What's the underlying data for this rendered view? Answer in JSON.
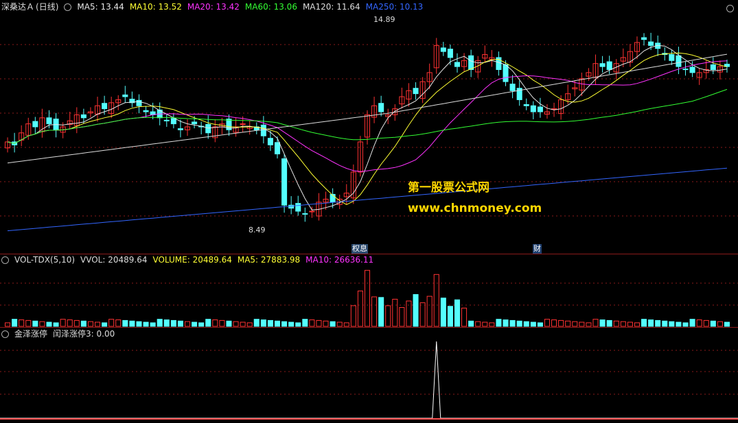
{
  "main": {
    "stock": "深桑达Ａ",
    "period": "(日线)",
    "ma": [
      {
        "label": "MA5: 13.44",
        "color": "#e6e6e6"
      },
      {
        "label": "MA10: 13.52",
        "color": "#ffff33"
      },
      {
        "label": "MA20: 13.42",
        "color": "#ff33ff"
      },
      {
        "label": "MA60: 13.06",
        "color": "#33ff33"
      },
      {
        "label": "MA120: 11.64",
        "color": "#dddddd"
      },
      {
        "label": "MA250: 10.13",
        "color": "#3366ff"
      }
    ],
    "high_label": "14.89",
    "low_label": "8.49",
    "tags": [
      "权息",
      "财"
    ]
  },
  "vol": {
    "title": "VOL-TDX(5,10)",
    "vvol": "VVOL: 20489.64",
    "volume": "VOLUME: 20489.64",
    "ma5": "MA5: 27883.98",
    "ma10": "MA10: 26636.11"
  },
  "ind": {
    "title": "金泽涨停",
    "value": "闰泽涨停3: 0.00"
  },
  "watermark": {
    "line1": "第一股票公式网",
    "line2": "www.chnmoney.com"
  },
  "colors": {
    "up": "#ff3232",
    "down": "#54ffff",
    "grid": "#8b1a1a",
    "ma5": "#e6e6e6",
    "ma10": "#ffff33",
    "ma20": "#ff33ff",
    "ma60": "#33ff33",
    "ma120": "#dddddd",
    "ma250": "#3366ff"
  },
  "chart_data": {
    "type": "candlestick",
    "price_range": [
      8.0,
      15.6
    ],
    "close": [
      11.3,
      11.2,
      11.6,
      11.9,
      11.8,
      12.1,
      11.9,
      11.7,
      11.8,
      12.0,
      12.2,
      12.1,
      12.3,
      12.5,
      12.4,
      12.6,
      12.7,
      12.8,
      12.6,
      12.5,
      12.3,
      12.2,
      12.1,
      12.0,
      11.9,
      11.7,
      11.8,
      11.9,
      11.8,
      11.6,
      11.8,
      11.9,
      11.7,
      11.8,
      11.9,
      11.8,
      11.7,
      11.5,
      11.2,
      10.9,
      9.2,
      9.1,
      9.0,
      8.9,
      9.0,
      9.3,
      9.4,
      9.3,
      9.4,
      9.6,
      10.3,
      11.3,
      12.2,
      12.5,
      12.3,
      12.2,
      12.4,
      12.8,
      13.0,
      12.9,
      13.3,
      13.6,
      14.5,
      14.3,
      14.1,
      13.8,
      14.0,
      13.7,
      14.0,
      14.2,
      14.1,
      13.7,
      13.3,
      13.0,
      12.7,
      12.5,
      12.3,
      12.3,
      12.3,
      12.4,
      12.7,
      12.9,
      13.1,
      13.4,
      13.6,
      13.9,
      13.8,
      13.7,
      13.9,
      14.1,
      14.3,
      14.6,
      14.7,
      14.5,
      14.4,
      14.2,
      14.0,
      13.8,
      13.7,
      13.6,
      13.6,
      13.7,
      13.7,
      13.8,
      13.8
    ]
  }
}
